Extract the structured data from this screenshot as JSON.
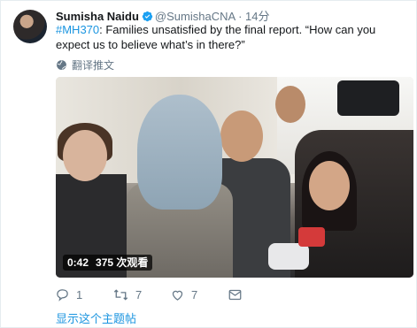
{
  "tweet": {
    "author_name": "Sumisha Naidu",
    "handle": "@SumishaCNA",
    "separator": "·",
    "time": "14分",
    "hashtag": "#MH370",
    "text_rest": ": Families unsatisfied by the final report. “How can you expect us to believe what’s in there?”",
    "translate_label": "翻译推文"
  },
  "video": {
    "duration": "0:42",
    "views": "375 次观看"
  },
  "actions": {
    "reply_count": "1",
    "retweet_count": "7",
    "like_count": "7"
  },
  "show_thread_label": "显示这个主题帖",
  "icons": [
    "verified-badge-icon",
    "globe-icon",
    "reply-icon",
    "retweet-icon",
    "like-icon",
    "message-icon"
  ],
  "colors": {
    "link": "#1b95e0",
    "muted": "#657786",
    "verified": "#1da1f2"
  }
}
